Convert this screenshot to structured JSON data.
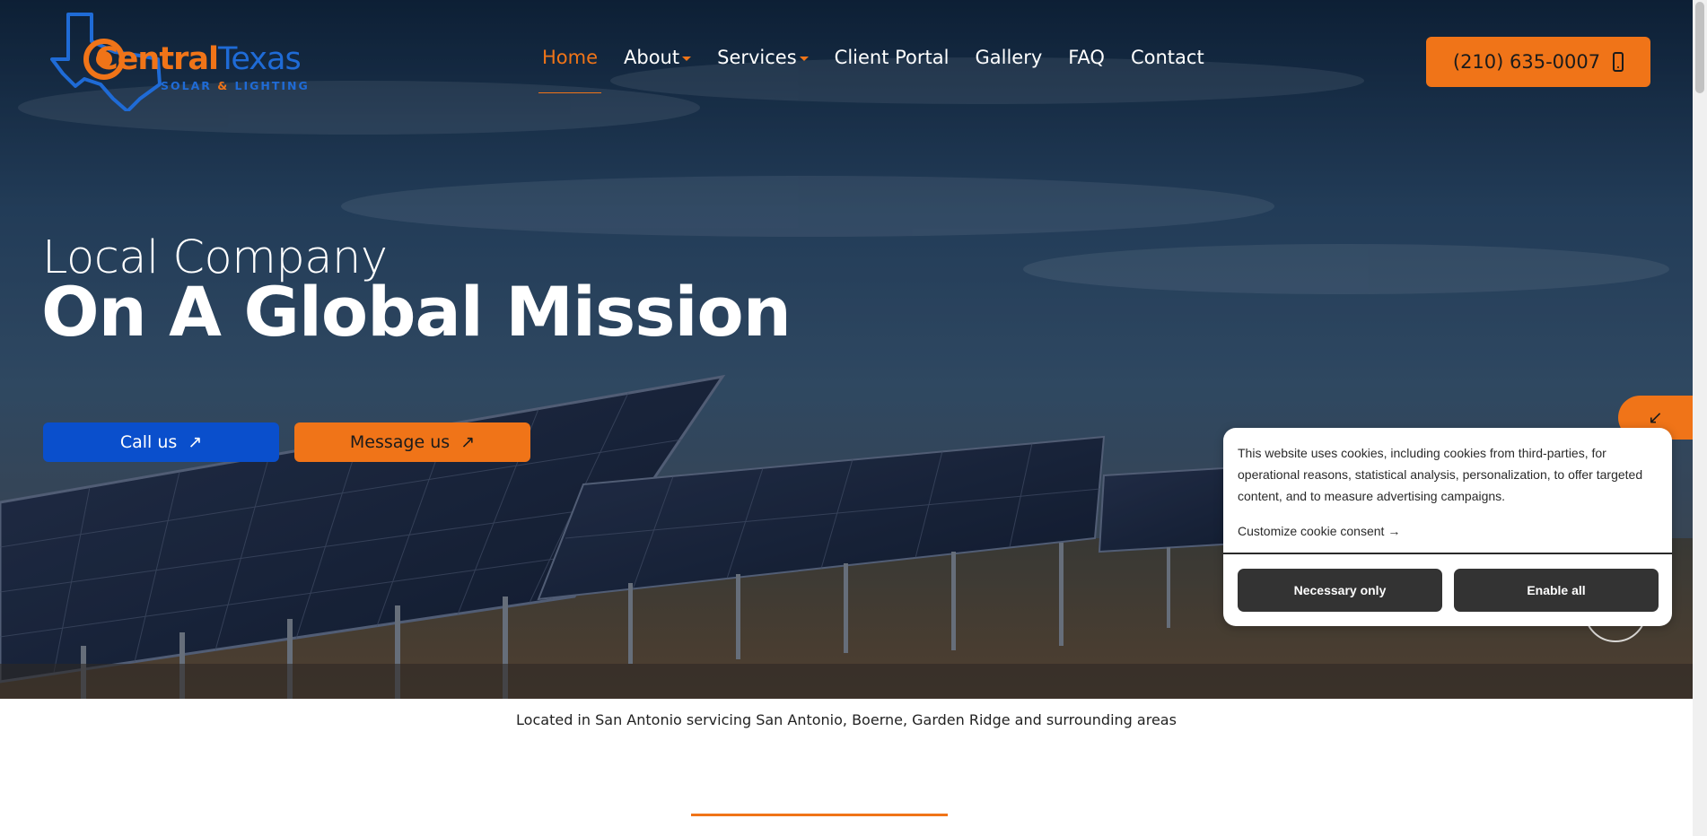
{
  "header": {
    "logo": {
      "brand_part1": "Central",
      "brand_part2": "Texas",
      "tagline_a": "SOLAR",
      "tagline_amp": "&",
      "tagline_b": "LIGHTING"
    },
    "nav": [
      {
        "label": "Home",
        "active": true,
        "dropdown": false
      },
      {
        "label": "About",
        "active": false,
        "dropdown": true
      },
      {
        "label": "Services",
        "active": false,
        "dropdown": true
      },
      {
        "label": "Client Portal",
        "active": false,
        "dropdown": false
      },
      {
        "label": "Gallery",
        "active": false,
        "dropdown": false
      },
      {
        "label": "FAQ",
        "active": false,
        "dropdown": false
      },
      {
        "label": "Contact",
        "active": false,
        "dropdown": false
      }
    ],
    "phone": {
      "label": "(210) 635-0007",
      "icon": "smartphone-icon"
    }
  },
  "hero": {
    "kicker": "Local Company",
    "headline": "On A Global Mission",
    "buttons": {
      "call": {
        "label": "Call us",
        "icon": "arrow-up-right-icon"
      },
      "message": {
        "label": "Message us",
        "icon": "arrow-up-right-icon"
      }
    },
    "side_tab": {
      "icon": "arrow-down-left-icon"
    }
  },
  "location_text": "Located in San Antonio servicing San Antonio, Boerne, Garden Ridge and surrounding areas",
  "cookie": {
    "message": "This website uses cookies, including cookies from third-parties, for operational reasons, statistical analysis, personalization, to offer targeted content, and to measure advertising campaigns.",
    "customize_label": "Customize cookie consent",
    "customize_icon": "arrow-right-icon",
    "necessary_label": "Necessary only",
    "enable_label": "Enable all"
  },
  "colors": {
    "accent_orange": "#f07418",
    "brand_blue": "#1f6bd6",
    "call_blue": "#0a4fcc",
    "cookie_button": "#333333"
  }
}
